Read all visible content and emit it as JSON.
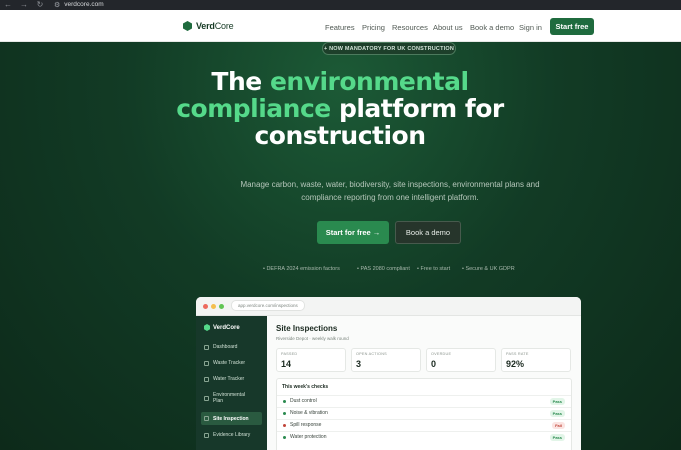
{
  "browser": {
    "url": "verdcore.com",
    "back_icon": "arrow-left-icon",
    "forward_icon": "arrow-right-icon",
    "reload_icon": "reload-icon",
    "site_info_icon": "tune-icon"
  },
  "nav": {
    "brand_bold": "Verd",
    "brand_rest": "Core",
    "links": [
      "Features",
      "Pricing",
      "Resources",
      "About us",
      "Book a demo",
      "Sign in"
    ],
    "cta": "Start free"
  },
  "hero": {
    "badge": "+ NOW MANDATORY FOR UK CONSTRUCTION",
    "headline_1": "The ",
    "headline_green": "environmental compliance",
    "headline_2": " platform for construction",
    "subtitle": "Manage carbon, waste, water, biodiversity, site inspections, environmental plans and compliance reporting from one intelligent platform.",
    "primary_cta": "Start for free →",
    "secondary_cta": "Book a demo",
    "features": [
      "• DEFRA 2024 emission factors",
      "• PAS 2080 compliant",
      "• Free to start",
      "• Secure & UK GDPR"
    ]
  },
  "app": {
    "url": "app.verdcore.com/inspections",
    "brand_bold": "Verd",
    "brand_rest": "Core",
    "sidebar": [
      {
        "label": "Dashboard",
        "active": false
      },
      {
        "label": "Waste Tracker",
        "active": false
      },
      {
        "label": "Water Tracker",
        "active": false
      },
      {
        "label": "Environmental Plan",
        "active": false
      },
      {
        "label": "Site Inspection",
        "active": true
      },
      {
        "label": "Evidence Library",
        "active": false
      }
    ],
    "title": "Site Inspections",
    "subtitle": "Riverside Depot · weekly walk round",
    "stats": [
      {
        "label": "PASSED",
        "value": "14"
      },
      {
        "label": "OPEN ACTIONS",
        "value": "3"
      },
      {
        "label": "OVERDUE",
        "value": "0"
      },
      {
        "label": "PASS RATE",
        "value": "92%"
      }
    ],
    "checks_title": "This week's checks",
    "checks": [
      {
        "label": "Dust control",
        "status": "Pass"
      },
      {
        "label": "Noise & vibration",
        "status": "Pass"
      },
      {
        "label": "Spill response",
        "status": "Fail"
      },
      {
        "label": "Water protection",
        "status": "Pass"
      }
    ]
  },
  "colors": {
    "brand_green": "#1f6b3e",
    "accent_green": "#55d98a",
    "pass": "#2a8a4f",
    "fail": "#c0453a"
  }
}
